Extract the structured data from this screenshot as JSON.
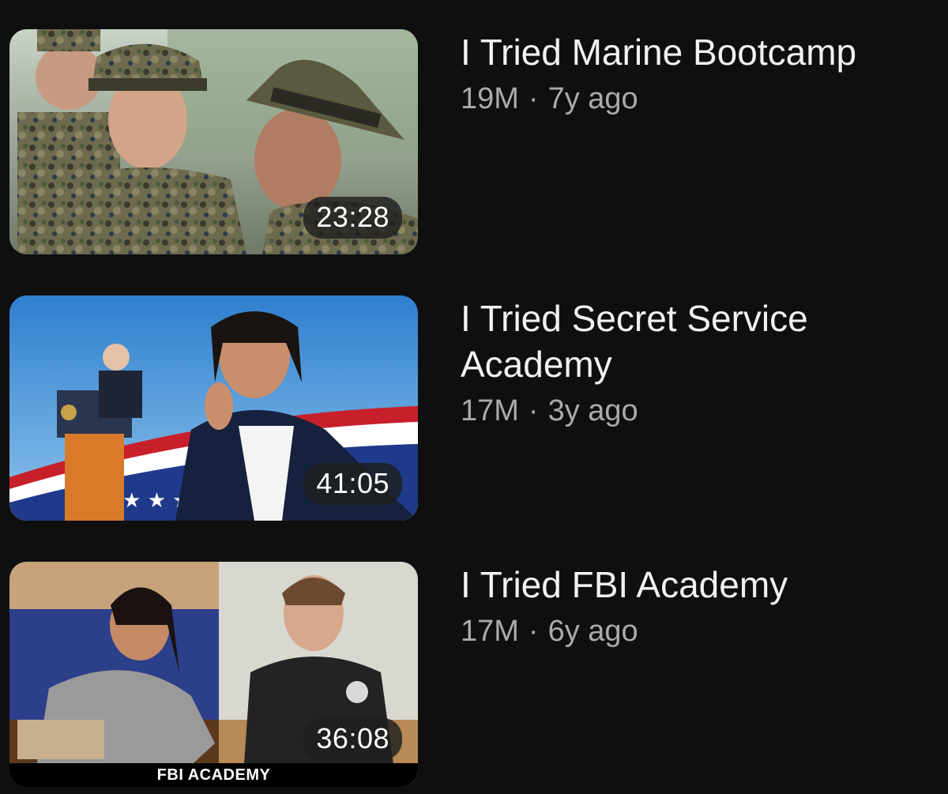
{
  "videos": [
    {
      "title": "I Tried Marine Bootcamp",
      "views": "19M",
      "separator": "·",
      "age": "7y ago",
      "duration": "23:28"
    },
    {
      "title": "I Tried Secret Service Academy",
      "views": "17M",
      "separator": "·",
      "age": "3y ago",
      "duration": "41:05"
    },
    {
      "title": "I Tried FBI Academy",
      "views": "17M",
      "separator": "·",
      "age": "6y ago",
      "duration": "36:08",
      "thumbnail_caption": "FBI ACADEMY"
    }
  ],
  "colors": {
    "background": "#0f0f0f",
    "title": "#f1f1f1",
    "meta": "#aaaaaa"
  }
}
